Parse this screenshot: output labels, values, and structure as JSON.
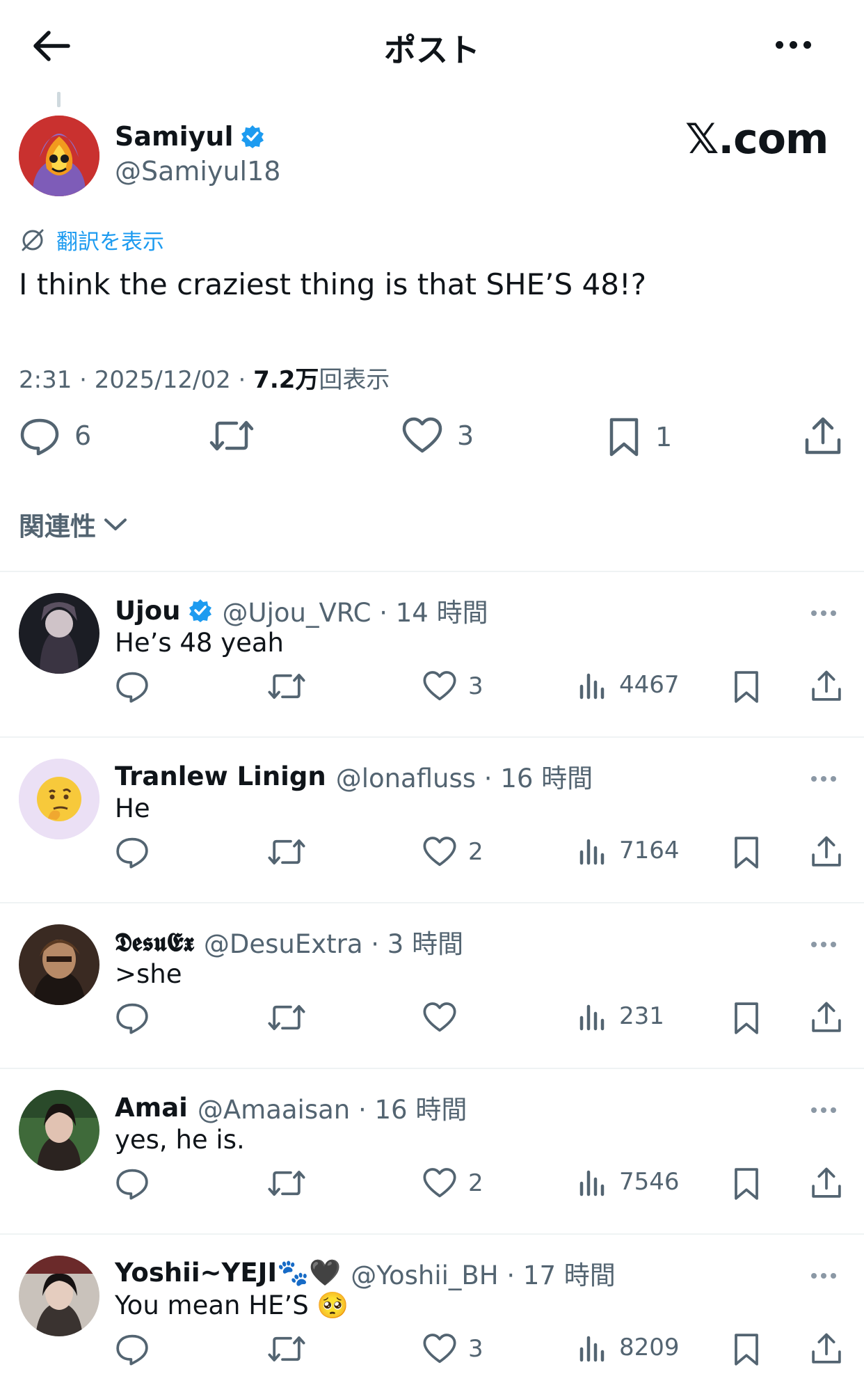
{
  "header": {
    "title": "ポスト"
  },
  "post": {
    "author_name": "Samiyul",
    "author_handle": "@Samiyul18",
    "watermark": "𝕏.com",
    "translate_label": "翻訳を表示",
    "text": "I think the craziest thing is that SHE’S 48!?",
    "time_date": "2:31 · 2025/12/02 · ",
    "views_count": "7.2万",
    "views_label": "回表示",
    "replies": "6",
    "reposts": "",
    "likes": "3",
    "bookmarks": "1"
  },
  "sort_label": "関連性",
  "replies": [
    {
      "name": "Ujou",
      "verified": true,
      "handle": "@Ujou_VRC · 14 時間",
      "text": "He’s 48 yeah",
      "likes": "3",
      "views": "4467"
    },
    {
      "name": "Tranlew Linign",
      "verified": false,
      "handle": "@lonafluss · 16 時間",
      "text": "He",
      "likes": "2",
      "views": "7164"
    },
    {
      "name": "𝕯𝖊𝖘𝖚𝕰𝖝",
      "verified": false,
      "handle": "@DesuExtra · 3 時間",
      "text": ">she",
      "likes": "",
      "views": "231"
    },
    {
      "name": "Amai",
      "verified": false,
      "handle": "@Amaaisan · 16 時間",
      "text": "yes, he is.",
      "likes": "2",
      "views": "7546"
    },
    {
      "name": "Yoshii~YEJI🐾🖤",
      "verified": false,
      "handle": "@Yoshii_BH · 17 時間",
      "text": "You mean HE’S 🥺",
      "likes": "3",
      "views": "8209"
    }
  ],
  "colors": {
    "accent": "#1d9bf0",
    "text": "#0f1419",
    "muted": "#536471",
    "divider": "#eff3f4"
  }
}
